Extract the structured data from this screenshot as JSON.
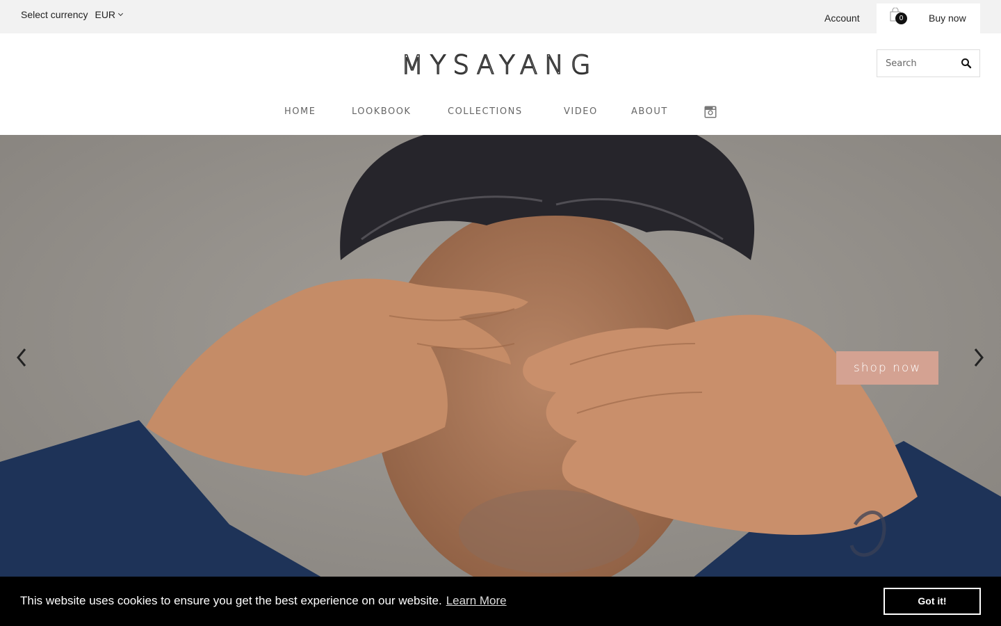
{
  "topbar": {
    "currency_label": "Select currency",
    "currency_value": "EUR",
    "account_label": "Account",
    "cart_count": "0",
    "buy_now_label": "Buy now"
  },
  "header": {
    "logo_text": "MYSAYANG",
    "search_placeholder": "Search"
  },
  "nav": {
    "items": [
      {
        "label": "HOME"
      },
      {
        "label": "LOOKBOOK"
      },
      {
        "label": "COLLECTIONS"
      },
      {
        "label": "VIDEO"
      },
      {
        "label": "ABOUT"
      }
    ],
    "social_icon": "instagram-icon"
  },
  "hero": {
    "cta_label": "shop now",
    "cta_color": "#d4a292"
  },
  "cookie_banner": {
    "message": "This website uses cookies to ensure you get the best experience on our website.",
    "link_label": "Learn More",
    "button_label": "Got it!"
  }
}
